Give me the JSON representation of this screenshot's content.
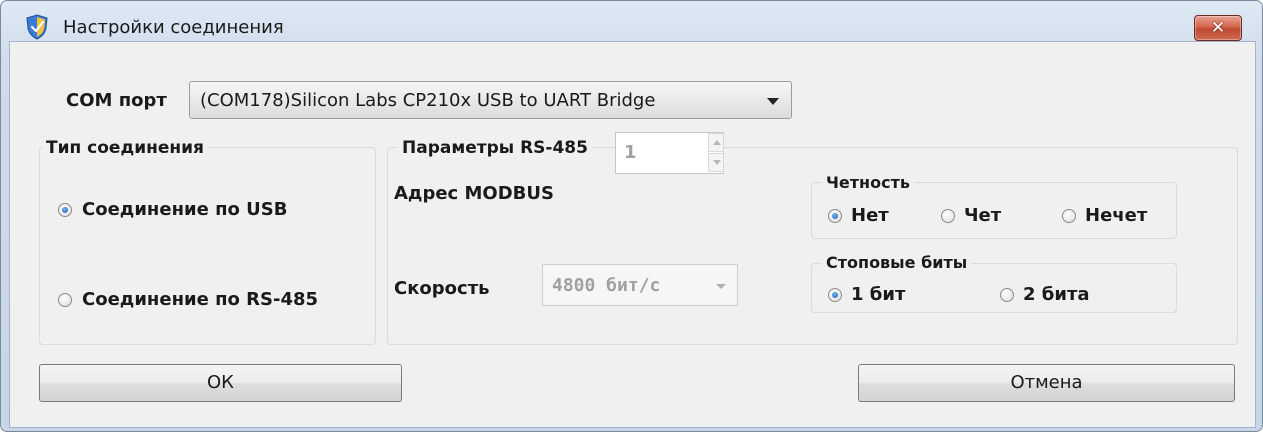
{
  "window": {
    "title": "Настройки соединения",
    "close_label": "✕"
  },
  "com_port": {
    "label": "COM порт",
    "value": "(COM178)Silicon Labs CP210x USB to UART Bridge"
  },
  "connection_type": {
    "title": "Тип соединения",
    "options": [
      {
        "label": "Соединение по USB",
        "selected": true
      },
      {
        "label": "Соединение по RS-485",
        "selected": false
      }
    ]
  },
  "rs485": {
    "title": "Параметры RS-485",
    "modbus_label": "Адрес MODBUS",
    "modbus_value": "1",
    "speed_label": "Скорость",
    "speed_value": "4800 бит/с",
    "parity": {
      "title": "Четность",
      "options": [
        {
          "label": "Нет",
          "selected": true
        },
        {
          "label": "Чет",
          "selected": false
        },
        {
          "label": "Нечет",
          "selected": false
        }
      ]
    },
    "stop_bits": {
      "title": "Стоповые биты",
      "options": [
        {
          "label": "1 бит",
          "selected": true
        },
        {
          "label": "2 бита",
          "selected": false
        }
      ]
    }
  },
  "buttons": {
    "ok": "ОК",
    "cancel": "Отмена"
  },
  "colors": {
    "close_button": "#c8523a",
    "radio_selected": "#1c5fb4",
    "disabled_text": "#a0a0a0"
  }
}
